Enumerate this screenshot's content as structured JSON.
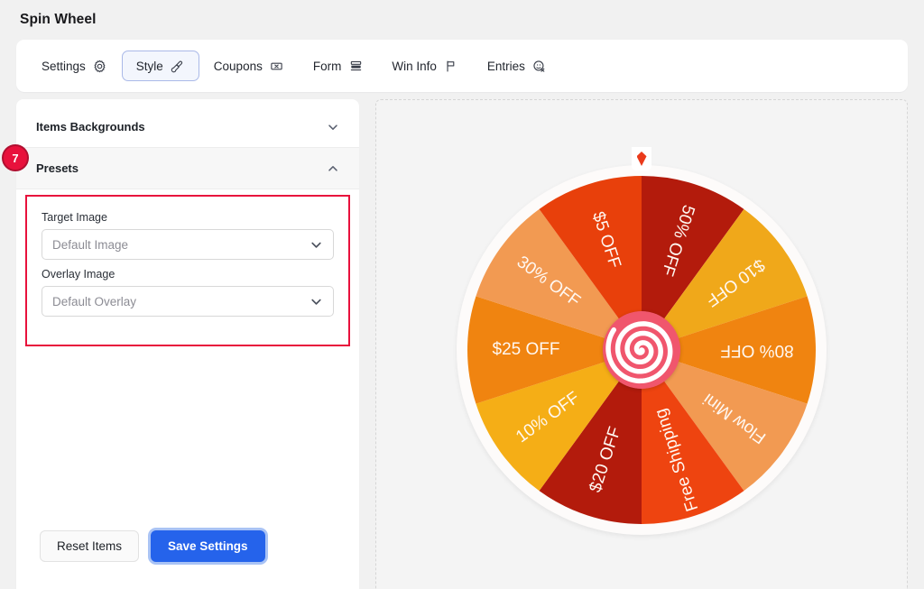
{
  "header": {
    "title": "Spin Wheel"
  },
  "tabs": [
    {
      "label": "Settings",
      "icon": "gear-icon",
      "active": false
    },
    {
      "label": "Style",
      "icon": "brush-icon",
      "active": true
    },
    {
      "label": "Coupons",
      "icon": "ticket-icon",
      "active": false
    },
    {
      "label": "Form",
      "icon": "form-icon",
      "active": false
    },
    {
      "label": "Win Info",
      "icon": "flag-icon",
      "active": false
    },
    {
      "label": "Entries",
      "icon": "user-check-icon",
      "active": false
    }
  ],
  "sidebar": {
    "sections": [
      {
        "title": "Items Backgrounds",
        "open": false,
        "chevron": "chevron-down-icon"
      },
      {
        "title": "Presets",
        "open": true,
        "chevron": "chevron-up-icon"
      }
    ],
    "step_badge": "7",
    "presets": {
      "fields": [
        {
          "label": "Target Image",
          "value": "Default Image",
          "name": "target-image-select"
        },
        {
          "label": "Overlay Image",
          "value": "Default Overlay",
          "name": "overlay-image-select"
        }
      ]
    },
    "footer": {
      "reset_label": "Reset Items",
      "save_label": "Save Settings"
    }
  },
  "preview": {
    "pointer": "pointer-marker",
    "hub": "spiral-hub",
    "wheel": {
      "segment_count": 10,
      "segments": [
        {
          "label": "50% OFF",
          "color": "#b31b0c"
        },
        {
          "label": "$10 OFF",
          "color": "#f0a81a"
        },
        {
          "label": "80% OFF",
          "color": "#f08410"
        },
        {
          "label": "Flow Mini",
          "color": "#f29a52"
        },
        {
          "label": "Free Shipping",
          "color": "#ee4410"
        },
        {
          "label": "$20 OFF",
          "color": "#b31b0c"
        },
        {
          "label": "10% OFF",
          "color": "#f5ae16"
        },
        {
          "label": "$25 OFF",
          "color": "#f08410"
        },
        {
          "label": "30% OFF",
          "color": "#f29a52"
        },
        {
          "label": "$5 OFF",
          "color": "#e8400b"
        }
      ]
    }
  },
  "colors": {
    "accent": "#2563eb",
    "marker": "#e8113c",
    "hub": "#f0566d",
    "page_bg": "#f1f1f1"
  }
}
